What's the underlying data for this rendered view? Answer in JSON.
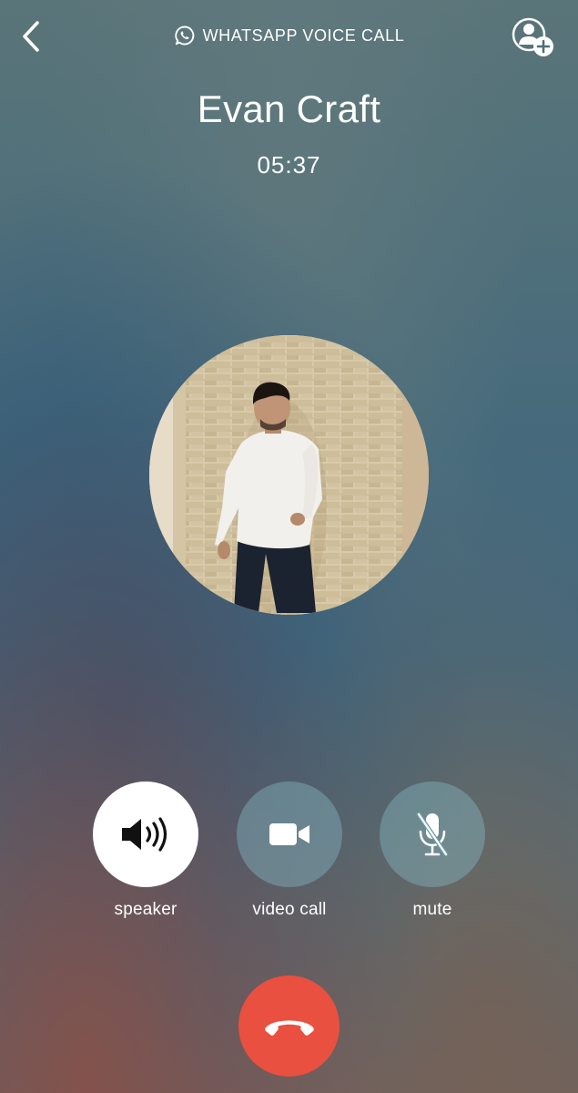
{
  "header": {
    "call_type_label": "WHATSAPP VOICE CALL"
  },
  "contact": {
    "name": "Evan Craft",
    "call_duration": "05:37"
  },
  "controls": [
    {
      "label": "speaker",
      "icon": "speaker-icon",
      "active": true
    },
    {
      "label": "video call",
      "icon": "video-camera-icon",
      "active": false
    },
    {
      "label": "mute",
      "icon": "microphone-muted-icon",
      "active": false
    }
  ],
  "end_call": {
    "icon": "end-call-icon",
    "color": "#e9503f"
  },
  "colors": {
    "active_control_bg": "#ffffff",
    "inactive_control_bg": "#82b4be",
    "text": "#ffffff"
  }
}
